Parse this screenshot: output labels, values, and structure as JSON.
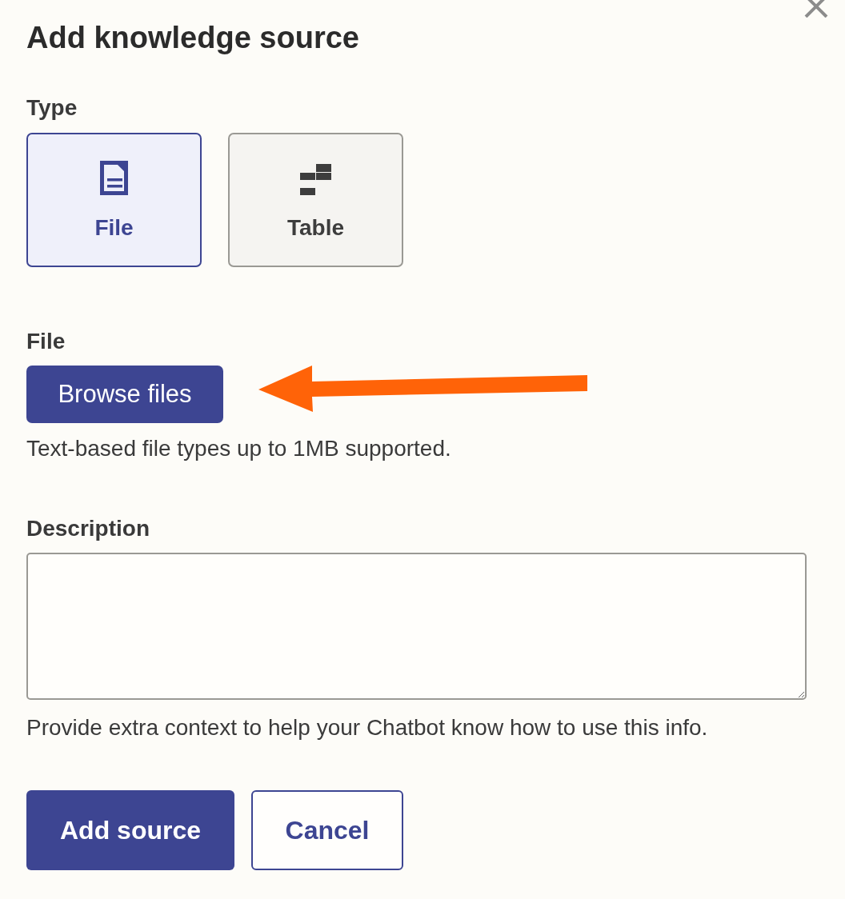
{
  "dialog": {
    "title": "Add knowledge source"
  },
  "type_field": {
    "label": "Type",
    "options": [
      {
        "label": "File",
        "kind": "file",
        "selected": true
      },
      {
        "label": "Table",
        "kind": "table",
        "selected": false
      }
    ]
  },
  "file_field": {
    "label": "File",
    "button": "Browse files",
    "help": "Text-based file types up to 1MB supported."
  },
  "description_field": {
    "label": "Description",
    "help": "Provide extra context to help your Chatbot know how to use this info."
  },
  "actions": [
    {
      "label": "Add source",
      "kind": "primary"
    },
    {
      "label": "Cancel",
      "kind": "secondary"
    }
  ]
}
